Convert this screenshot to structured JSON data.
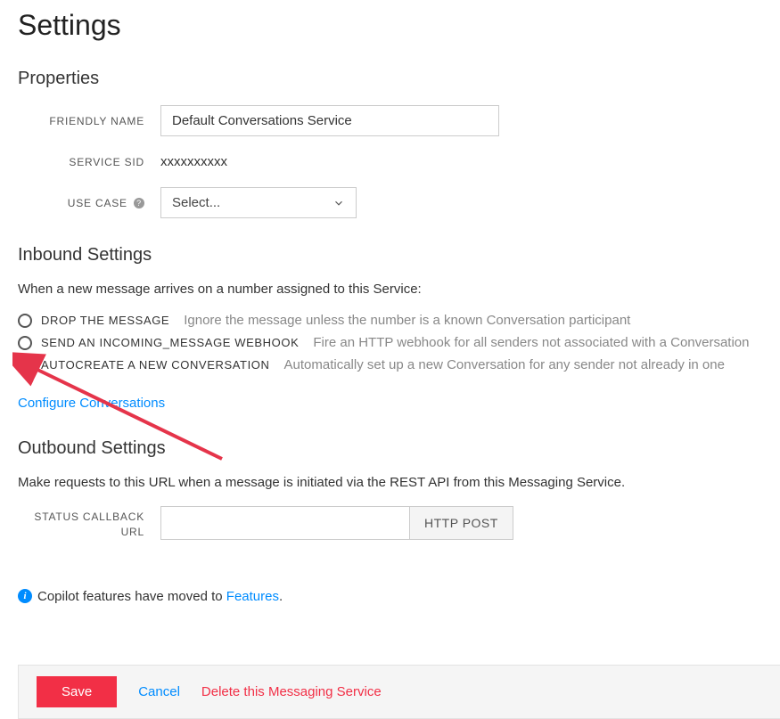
{
  "page_title": "Settings",
  "sections": {
    "properties": {
      "heading": "Properties",
      "friendly_name_label": "FRIENDLY NAME",
      "friendly_name_value": "Default Conversations Service",
      "service_sid_label": "SERVICE SID",
      "service_sid_value": "xxxxxxxxxx",
      "use_case_label": "USE CASE",
      "use_case_selected": "Select..."
    },
    "inbound": {
      "heading": "Inbound Settings",
      "intro": "When a new message arrives on a number assigned to this Service:",
      "options": [
        {
          "label": "DROP THE MESSAGE",
          "desc": "Ignore the message unless the number is a known Conversation participant",
          "checked": false
        },
        {
          "label": "SEND AN INCOMING_MESSAGE WEBHOOK",
          "desc": "Fire an HTTP webhook for all senders not associated with a Conversation",
          "checked": false
        },
        {
          "label": "AUTOCREATE A NEW CONVERSATION",
          "desc": "Automatically set up a new Conversation for any sender not already in one",
          "checked": true
        }
      ],
      "configure_link": "Configure Conversations"
    },
    "outbound": {
      "heading": "Outbound Settings",
      "intro": "Make requests to this URL when a message is initiated via the REST API from this Messaging Service.",
      "status_callback_label": "STATUS CALLBACK URL",
      "status_callback_value": "",
      "method": "HTTP POST"
    },
    "info": {
      "prefix": "Copilot features have moved to ",
      "link": "Features",
      "suffix": "."
    }
  },
  "footer": {
    "save": "Save",
    "cancel": "Cancel",
    "delete": "Delete this Messaging Service"
  }
}
